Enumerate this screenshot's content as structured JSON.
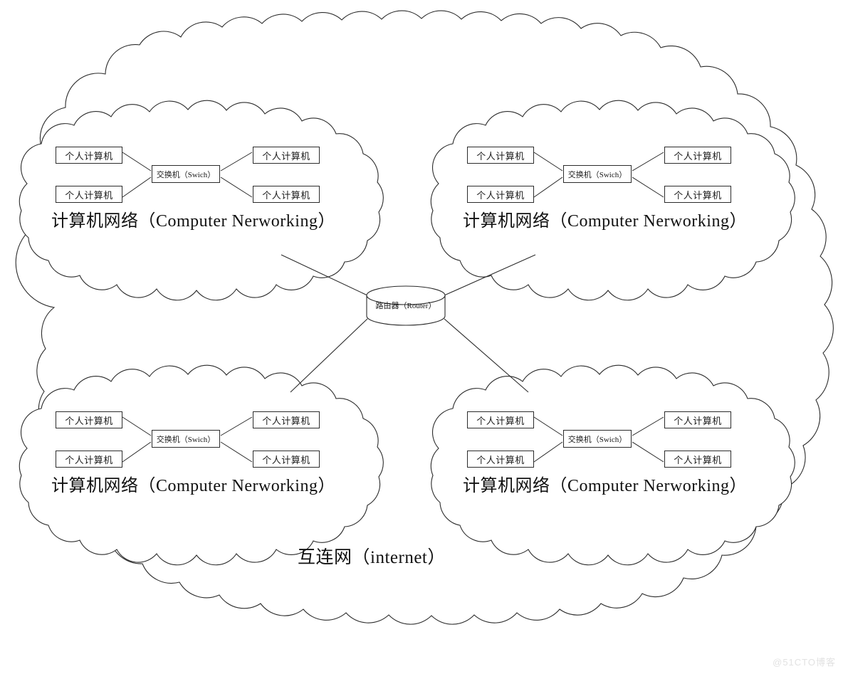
{
  "diagram": {
    "title": "互连网（internet）",
    "outer_label": "互连网（internet）",
    "stroke_color": "#2b2b2b",
    "background_color": "#ffffff",
    "router": {
      "label": "路由器（Router）",
      "shape": "cylinder"
    },
    "networks": [
      {
        "id": "network-top-left",
        "caption": "计算机网络（Computer Nerworking）",
        "switch": "交换机（Swich）",
        "pcs": [
          "个人计算机",
          "个人计算机",
          "个人计算机",
          "个人计算机"
        ]
      },
      {
        "id": "network-top-right",
        "caption": "计算机网络（Computer Nerworking）",
        "switch": "交换机（Swich）",
        "pcs": [
          "个人计算机",
          "个人计算机",
          "个人计算机",
          "个人计算机"
        ]
      },
      {
        "id": "network-bottom-left",
        "caption": "计算机网络（Computer Nerworking）",
        "switch": "交换机（Swich）",
        "pcs": [
          "个人计算机",
          "个人计算机",
          "个人计算机",
          "个人计算机"
        ]
      },
      {
        "id": "network-bottom-right",
        "caption": "计算机网络（Computer Nerworking）",
        "switch": "交换机（Swich）",
        "pcs": [
          "个人计算机",
          "个人计算机",
          "个人计算机",
          "个人计算机"
        ]
      }
    ]
  },
  "watermark": {
    "text": "@51CTO博客"
  }
}
